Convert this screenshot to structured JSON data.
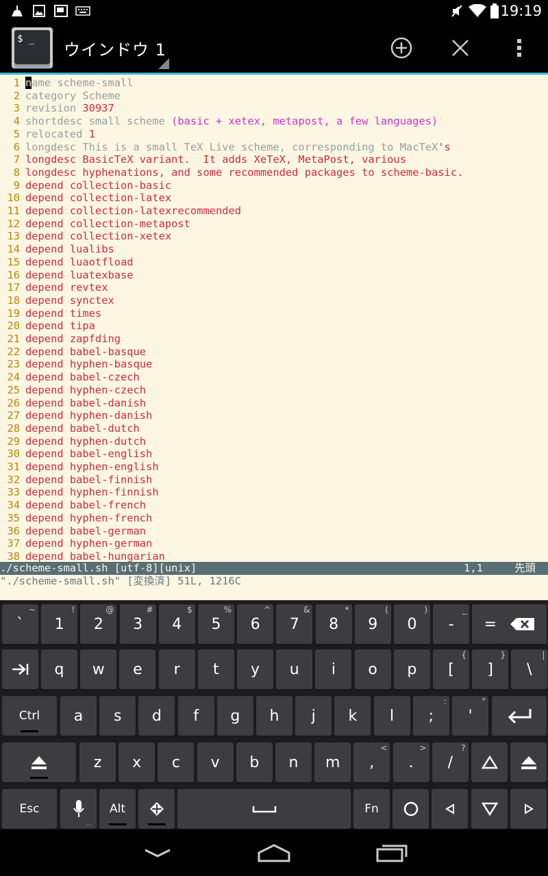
{
  "status_bar": {
    "time": "19:19",
    "left_icons": [
      "cleaner-icon",
      "image-icon",
      "screen-icon",
      "keyboard-icon"
    ],
    "right_icons": [
      "mute-icon",
      "wifi-icon",
      "battery-icon"
    ]
  },
  "action_bar": {
    "window_title": "ウインドウ 1",
    "icon_label": "$ _",
    "buttons": [
      "add-window-icon",
      "close-window-icon",
      "overflow-menu-icon"
    ]
  },
  "terminal": {
    "lines": [
      {
        "n": "1",
        "cursor": "n",
        "segs": [
          {
            "t": "ame scheme-small",
            "c": "c-name"
          }
        ]
      },
      {
        "n": "2",
        "segs": [
          {
            "t": "category Scheme",
            "c": "c-plain"
          }
        ]
      },
      {
        "n": "3",
        "segs": [
          {
            "t": "revision ",
            "c": "c-plain"
          },
          {
            "t": "30937",
            "c": "c-num"
          }
        ]
      },
      {
        "n": "4",
        "segs": [
          {
            "t": "shortdesc small scheme ",
            "c": "c-plain"
          },
          {
            "t": "(basic + xetex, metapost, a few languages)",
            "c": "c-mag"
          }
        ]
      },
      {
        "n": "5",
        "segs": [
          {
            "t": "relocated ",
            "c": "c-plain"
          },
          {
            "t": "1",
            "c": "c-num"
          }
        ]
      },
      {
        "n": "6",
        "segs": [
          {
            "t": "longdesc This is a small TeX Live scheme, corresponding to MacTeX",
            "c": "c-plain"
          },
          {
            "t": "'s",
            "c": "c-red"
          }
        ]
      },
      {
        "n": "7",
        "segs": [
          {
            "t": "longdesc BasicTeX variant.  It adds XeTeX, MetaPost, various",
            "c": "c-red"
          }
        ]
      },
      {
        "n": "8",
        "segs": [
          {
            "t": "longdesc hyphenations, and some recommended packages to scheme-basic.",
            "c": "c-red"
          }
        ]
      },
      {
        "n": "9",
        "segs": [
          {
            "t": "depend collection-basic",
            "c": "c-red"
          }
        ]
      },
      {
        "n": "10",
        "segs": [
          {
            "t": "depend collection-latex",
            "c": "c-red"
          }
        ]
      },
      {
        "n": "11",
        "segs": [
          {
            "t": "depend collection-latexrecommended",
            "c": "c-red"
          }
        ]
      },
      {
        "n": "12",
        "segs": [
          {
            "t": "depend collection-metapost",
            "c": "c-red"
          }
        ]
      },
      {
        "n": "13",
        "segs": [
          {
            "t": "depend collection-xetex",
            "c": "c-red"
          }
        ]
      },
      {
        "n": "14",
        "segs": [
          {
            "t": "depend lualibs",
            "c": "c-red"
          }
        ]
      },
      {
        "n": "15",
        "segs": [
          {
            "t": "depend luaotfload",
            "c": "c-red"
          }
        ]
      },
      {
        "n": "16",
        "segs": [
          {
            "t": "depend luatexbase",
            "c": "c-red"
          }
        ]
      },
      {
        "n": "17",
        "segs": [
          {
            "t": "depend revtex",
            "c": "c-red"
          }
        ]
      },
      {
        "n": "18",
        "segs": [
          {
            "t": "depend synctex",
            "c": "c-red"
          }
        ]
      },
      {
        "n": "19",
        "segs": [
          {
            "t": "depend times",
            "c": "c-red"
          }
        ]
      },
      {
        "n": "20",
        "segs": [
          {
            "t": "depend tipa",
            "c": "c-red"
          }
        ]
      },
      {
        "n": "21",
        "segs": [
          {
            "t": "depend zapfding",
            "c": "c-red"
          }
        ]
      },
      {
        "n": "22",
        "segs": [
          {
            "t": "depend babel-basque",
            "c": "c-red"
          }
        ]
      },
      {
        "n": "23",
        "segs": [
          {
            "t": "depend hyphen-basque",
            "c": "c-red"
          }
        ]
      },
      {
        "n": "24",
        "segs": [
          {
            "t": "depend babel-czech",
            "c": "c-red"
          }
        ]
      },
      {
        "n": "25",
        "segs": [
          {
            "t": "depend hyphen-czech",
            "c": "c-red"
          }
        ]
      },
      {
        "n": "26",
        "segs": [
          {
            "t": "depend babel-danish",
            "c": "c-red"
          }
        ]
      },
      {
        "n": "27",
        "segs": [
          {
            "t": "depend hyphen-danish",
            "c": "c-red"
          }
        ]
      },
      {
        "n": "28",
        "segs": [
          {
            "t": "depend babel-dutch",
            "c": "c-red"
          }
        ]
      },
      {
        "n": "29",
        "segs": [
          {
            "t": "depend hyphen-dutch",
            "c": "c-red"
          }
        ]
      },
      {
        "n": "30",
        "segs": [
          {
            "t": "depend babel-english",
            "c": "c-red"
          }
        ]
      },
      {
        "n": "31",
        "segs": [
          {
            "t": "depend hyphen-english",
            "c": "c-red"
          }
        ]
      },
      {
        "n": "32",
        "segs": [
          {
            "t": "depend babel-finnish",
            "c": "c-red"
          }
        ]
      },
      {
        "n": "33",
        "segs": [
          {
            "t": "depend hyphen-finnish",
            "c": "c-red"
          }
        ]
      },
      {
        "n": "34",
        "segs": [
          {
            "t": "depend babel-french",
            "c": "c-red"
          }
        ]
      },
      {
        "n": "35",
        "segs": [
          {
            "t": "depend hyphen-french",
            "c": "c-red"
          }
        ]
      },
      {
        "n": "36",
        "segs": [
          {
            "t": "depend babel-german",
            "c": "c-red"
          }
        ]
      },
      {
        "n": "37",
        "segs": [
          {
            "t": "depend hyphen-german",
            "c": "c-red"
          }
        ]
      },
      {
        "n": "38",
        "segs": [
          {
            "t": "depend babel-hungarian",
            "c": "c-red"
          }
        ]
      }
    ],
    "status_line_left": "./scheme-small.sh [utf-8][unix]",
    "status_line_pos": "1,1",
    "status_line_top": "先頭",
    "message_line": "\"./scheme-small.sh\" [変換済] 51L, 1216C"
  },
  "keyboard": {
    "row1": [
      {
        "l": "`",
        "h": "~"
      },
      {
        "l": "1",
        "h": "!"
      },
      {
        "l": "2",
        "h": "@"
      },
      {
        "l": "3",
        "h": "#"
      },
      {
        "l": "4",
        "h": "$"
      },
      {
        "l": "5",
        "h": "%"
      },
      {
        "l": "6",
        "h": "^"
      },
      {
        "l": "7",
        "h": "&"
      },
      {
        "l": "8",
        "h": "*"
      },
      {
        "l": "9",
        "h": "("
      },
      {
        "l": "0",
        "h": ")"
      },
      {
        "l": "-",
        "h": "_"
      },
      {
        "l": "=",
        "h": "+"
      }
    ],
    "row2": [
      {
        "l": "q",
        "h": ""
      },
      {
        "l": "w",
        "h": ""
      },
      {
        "l": "e",
        "h": ""
      },
      {
        "l": "r",
        "h": ""
      },
      {
        "l": "t",
        "h": ""
      },
      {
        "l": "y",
        "h": ""
      },
      {
        "l": "u",
        "h": ""
      },
      {
        "l": "i",
        "h": ""
      },
      {
        "l": "o",
        "h": ""
      },
      {
        "l": "p",
        "h": ""
      },
      {
        "l": "[",
        "h": "{"
      },
      {
        "l": "]",
        "h": "}"
      },
      {
        "l": "\\",
        "h": "|"
      }
    ],
    "row3": [
      {
        "l": "a",
        "h": ""
      },
      {
        "l": "s",
        "h": ""
      },
      {
        "l": "d",
        "h": ""
      },
      {
        "l": "f",
        "h": ""
      },
      {
        "l": "g",
        "h": ""
      },
      {
        "l": "h",
        "h": ""
      },
      {
        "l": "j",
        "h": ""
      },
      {
        "l": "k",
        "h": ""
      },
      {
        "l": "l",
        "h": ""
      },
      {
        "l": ";",
        "h": ":"
      },
      {
        "l": "'",
        "h": "\""
      }
    ],
    "row4": [
      {
        "l": "z",
        "h": ""
      },
      {
        "l": "x",
        "h": ""
      },
      {
        "l": "c",
        "h": ""
      },
      {
        "l": "v",
        "h": ""
      },
      {
        "l": "b",
        "h": ""
      },
      {
        "l": "n",
        "h": ""
      },
      {
        "l": "m",
        "h": ""
      },
      {
        "l": ",",
        "h": "<"
      },
      {
        "l": ".",
        "h": ">"
      },
      {
        "l": "/",
        "h": "?"
      }
    ],
    "ctrl": "Ctrl",
    "esc": "Esc",
    "alt": "Alt",
    "fn": "Fn",
    "dots": "..."
  }
}
